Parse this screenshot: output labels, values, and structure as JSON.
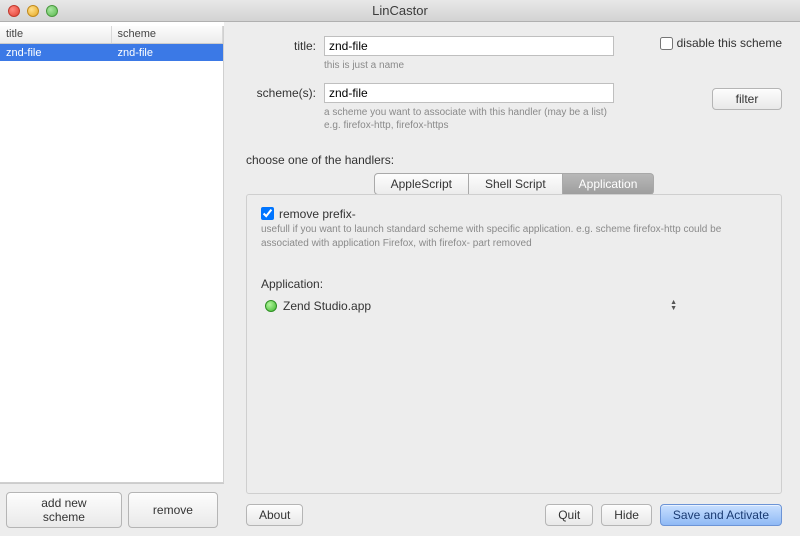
{
  "window": {
    "title": "LinCastor"
  },
  "sidebar": {
    "columns": [
      "title",
      "scheme"
    ],
    "rows": [
      {
        "title": "znd-file",
        "scheme": "znd-file",
        "selected": true
      }
    ],
    "add_label": "add new scheme",
    "remove_label": "remove"
  },
  "form": {
    "title_label": "title:",
    "title_value": "znd-file",
    "title_hint": "this is just a name",
    "scheme_label": "scheme(s):",
    "scheme_value": "znd-file",
    "scheme_hint": "a scheme you want to associate with this handler (may be a list)\ne.g. firefox-http, firefox-https",
    "disable_label": "disable this scheme",
    "filter_label": "filter",
    "handlers_label": "choose one of the handlers:"
  },
  "tabs": {
    "items": [
      "AppleScript",
      "Shell Script",
      "Application"
    ],
    "active_index": 2
  },
  "panel": {
    "remove_prefix_label": "remove prefix-",
    "remove_prefix_checked": true,
    "remove_prefix_hint": "usefull if you want to launch standard scheme with specific application. e.g. scheme firefox-http could be associated with application Firefox, with firefox- part removed",
    "application_label": "Application:",
    "application_value": "Zend Studio.app"
  },
  "footer": {
    "about": "About",
    "quit": "Quit",
    "hide": "Hide",
    "save": "Save and Activate"
  }
}
